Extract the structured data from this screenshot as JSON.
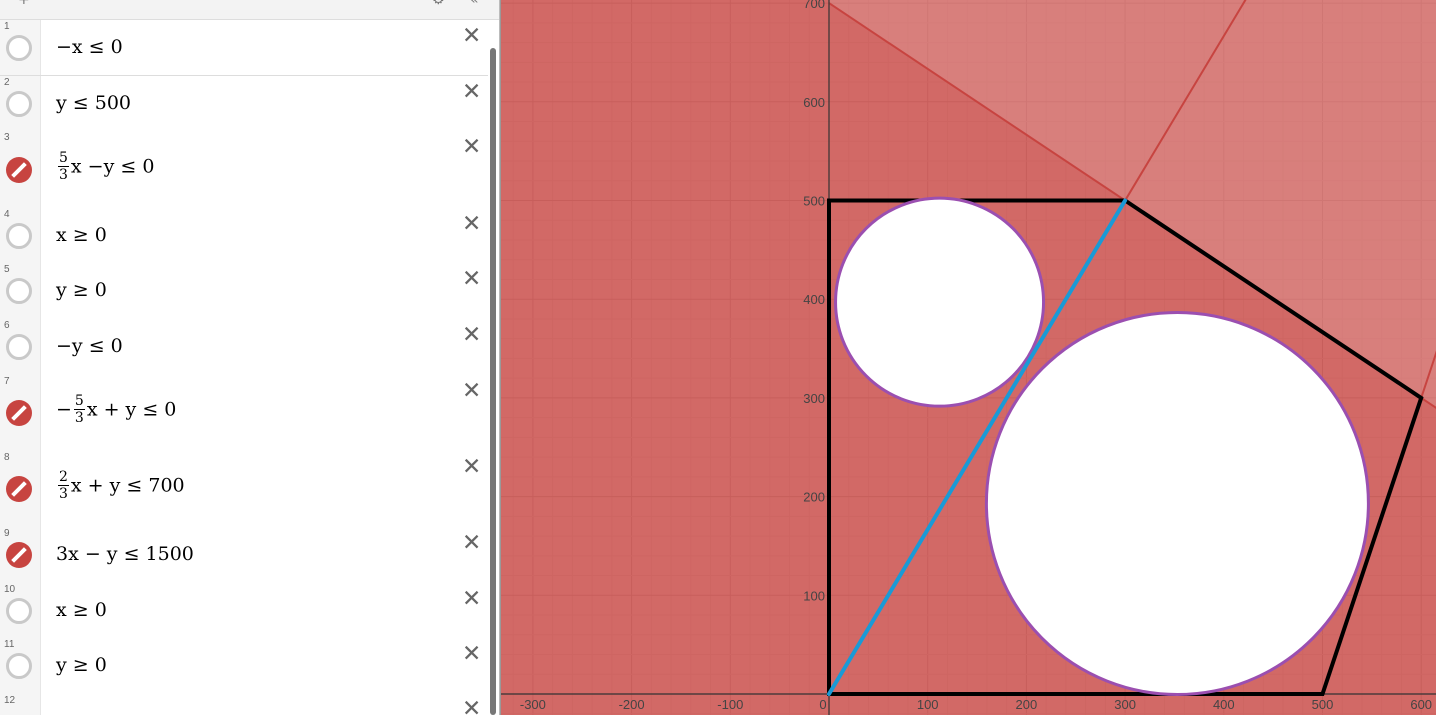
{
  "expressions": [
    {
      "num": "1",
      "latex": "−x ≤ 0",
      "active": false
    },
    {
      "num": "2",
      "latex": "y ≤ 500",
      "active": false
    },
    {
      "num": "3",
      "latex": "5/3 x − y ≤ 0",
      "active": true,
      "frac": {
        "n": "5",
        "d": "3"
      },
      "before": "",
      "after": "x −y ≤ 0"
    },
    {
      "num": "4",
      "latex": "x ≥ 0",
      "active": false
    },
    {
      "num": "5",
      "latex": "y ≥ 0",
      "active": false
    },
    {
      "num": "6",
      "latex": "−y ≤ 0",
      "active": false
    },
    {
      "num": "7",
      "latex": "−5/3 x + y ≤ 0",
      "active": true,
      "frac": {
        "n": "5",
        "d": "3"
      },
      "before": "−",
      "after": "x + y ≤ 0"
    },
    {
      "num": "8",
      "latex": "2/3 x + y ≤ 700",
      "active": true,
      "frac": {
        "n": "2",
        "d": "3"
      },
      "before": "",
      "after": "x + y ≤ 700"
    },
    {
      "num": "9",
      "latex": "3x − y ≤ 1500",
      "active": true
    },
    {
      "num": "10",
      "latex": "x ≥ 0",
      "active": false
    },
    {
      "num": "11",
      "latex": "y ≥ 0",
      "active": false
    },
    {
      "num": "12",
      "latex": "",
      "active": false
    }
  ],
  "graph": {
    "x_ticks": [
      "-300",
      "-200",
      "-100",
      "0",
      "100",
      "200",
      "300",
      "400",
      "500",
      "600"
    ],
    "y_ticks": [
      "100",
      "200",
      "300",
      "400",
      "500",
      "600",
      "700"
    ],
    "shade_color": "#c74440",
    "circle_color": "#9b4fb0",
    "segment_color": "#1a9ad6",
    "polygon_color": "#000000"
  }
}
